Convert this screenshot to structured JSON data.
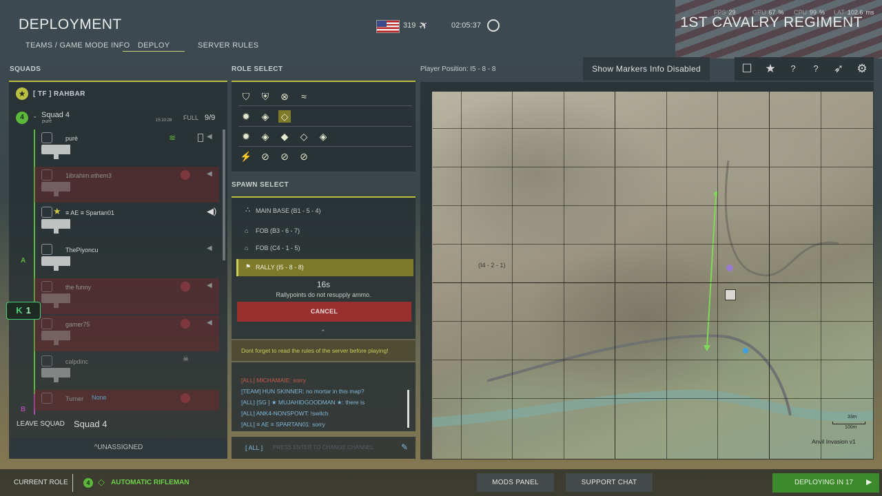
{
  "header": {
    "title": "DEPLOYMENT",
    "tabs": [
      "TEAMS / GAME MODE INFO",
      "DEPLOY",
      "SERVER RULES"
    ],
    "player_count": "319",
    "timer": "02:05:37",
    "regiment": "1ST CAVALRY REGIMENT",
    "stats": {
      "fps_label": "FPS",
      "fps": "29",
      "gpu_label": "GPU",
      "gpu": "67",
      "cpu_label": "CPU",
      "cpu": "99",
      "lat_label": "LAT",
      "lat": "102.6"
    }
  },
  "squads": {
    "heading": "SQUADS",
    "faction": "[ TF ] RAHBAR",
    "squad_number": "4",
    "squad_name": "Squad 4",
    "squad_leader": "purè",
    "squad_time": "15:10:28",
    "squad_status": "FULL",
    "squad_count": "9/9",
    "members": [
      {
        "name": "purè",
        "dead": false
      },
      {
        "name": "1ibrahim.ethem3",
        "dead": true
      },
      {
        "name": "≡ AE ≡  Spartan01",
        "dead": false
      },
      {
        "name": "ThePiyoncu",
        "dead": false
      },
      {
        "name": "the funny",
        "dead": true
      },
      {
        "name": "gamer75",
        "dead": true
      },
      {
        "name": "calpdinc",
        "dead": false
      },
      {
        "name": "Turner",
        "dead": true,
        "extra": "None"
      }
    ],
    "fireteam_a": "A",
    "fireteam_b": "B",
    "kit_badge": "1",
    "leave_squad": "LEAVE SQUAD",
    "leave_squad_name": "Squad 4",
    "unassigned": "^UNASSIGNED"
  },
  "roles": {
    "heading": "ROLE SELECT"
  },
  "spawn": {
    "heading": "SPAWN SELECT",
    "points": [
      {
        "label": "MAIN BASE (B1 - 5 - 4)"
      },
      {
        "label": "FOB (B3 - 6 - 7)"
      },
      {
        "label": "FOB (C4 - 1 - 5)"
      },
      {
        "label": "RALLY (I5 - 8 - 8)"
      }
    ],
    "countdown": "16s",
    "note": "Rallypoints do not resupply ammo.",
    "cancel": "CANCEL"
  },
  "chat": {
    "notice": "Dont forget to read the rules of the server before playing!",
    "messages": [
      {
        "text": "[ALL] MICHAMAIE: sorry",
        "color": "#c75a4a"
      },
      {
        "text": "[TEAM] HUN SKINNER: no mortar in this map?",
        "color": "#7fb7d8"
      },
      {
        "text": "[ALL] [SG ] ★ MUJAHIDGOODMAN ★: there is",
        "color": "#7fb7d8"
      },
      {
        "text": "[ALL] ANK4-NONSPOWT: !switch",
        "color": "#7fb7d8"
      },
      {
        "text": "[ALL] ≡ AE ≡  SPARTAN01: sorry",
        "color": "#7fb7d8"
      }
    ],
    "channel": "[ ALL ]",
    "input_placeholder": "PRESS ENTER TO CHANGE CHANNEL"
  },
  "map": {
    "player_position": "Player Position: I5 - 8 - 8",
    "markers_button": "Show Markers Info Disabled",
    "grid_label": "(I4 - 2 - 1)",
    "scale_small": "33m",
    "scale_large": "100m",
    "map_name": "Anvil Invasion v1"
  },
  "footer": {
    "current_role_label": "CURRENT ROLE",
    "role_number": "4",
    "role_name": "AUTOMATIC RIFLEMAN",
    "mods_panel": "MODS PANEL",
    "support_chat": "SUPPORT CHAT",
    "deploying": "DEPLOYING IN 17"
  },
  "colors": {
    "accent": "#b9c042",
    "deploy_green": "#3d8a2c",
    "cancel_red": "#9a2f2f",
    "rally_yellow": "#7d7a2a"
  }
}
